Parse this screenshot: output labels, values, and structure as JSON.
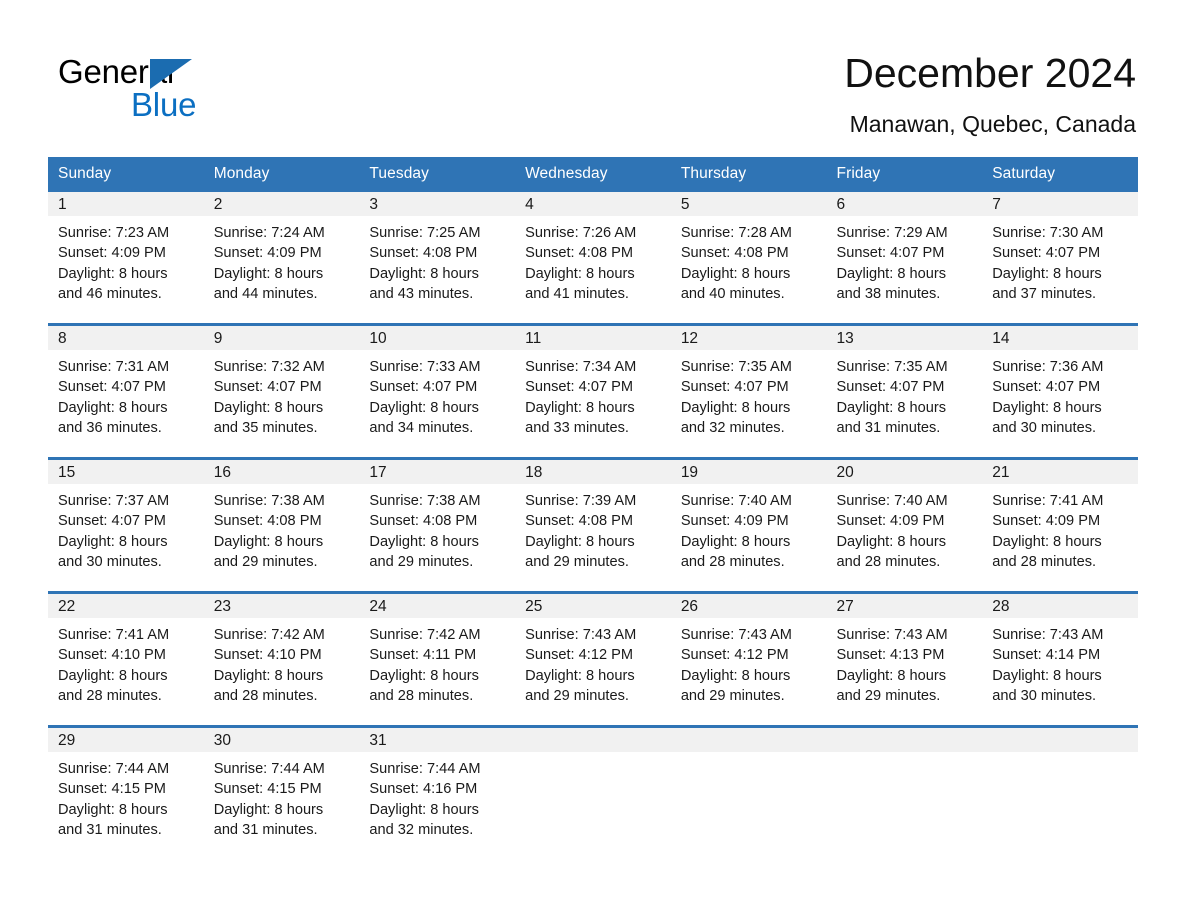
{
  "brand": {
    "name_part1": "General",
    "name_part2": "Blue",
    "accent_color": "#0b6fc2",
    "triangle_color": "#1b6cb0",
    "logo_icon": "blue-triangle-icon"
  },
  "header": {
    "title": "December 2024",
    "subtitle": "Manawan, Quebec, Canada"
  },
  "theme": {
    "header_bg": "#2f74b5",
    "header_text": "#ffffff",
    "daynum_band_bg": "#f1f1f1",
    "cell_bg": "#ffffff",
    "row_divider": "#2f74b5",
    "body_text": "#1a1a1a"
  },
  "weekday_headers": [
    "Sunday",
    "Monday",
    "Tuesday",
    "Wednesday",
    "Thursday",
    "Friday",
    "Saturday"
  ],
  "labels": {
    "sunrise_prefix": "Sunrise:",
    "sunset_prefix": "Sunset:",
    "daylight_prefix": "Daylight:"
  },
  "weeks": [
    [
      {
        "day": "1",
        "sunrise": "Sunrise: 7:23 AM",
        "sunset": "Sunset: 4:09 PM",
        "daylight_line1": "Daylight: 8 hours",
        "daylight_line2": "and 46 minutes."
      },
      {
        "day": "2",
        "sunrise": "Sunrise: 7:24 AM",
        "sunset": "Sunset: 4:09 PM",
        "daylight_line1": "Daylight: 8 hours",
        "daylight_line2": "and 44 minutes."
      },
      {
        "day": "3",
        "sunrise": "Sunrise: 7:25 AM",
        "sunset": "Sunset: 4:08 PM",
        "daylight_line1": "Daylight: 8 hours",
        "daylight_line2": "and 43 minutes."
      },
      {
        "day": "4",
        "sunrise": "Sunrise: 7:26 AM",
        "sunset": "Sunset: 4:08 PM",
        "daylight_line1": "Daylight: 8 hours",
        "daylight_line2": "and 41 minutes."
      },
      {
        "day": "5",
        "sunrise": "Sunrise: 7:28 AM",
        "sunset": "Sunset: 4:08 PM",
        "daylight_line1": "Daylight: 8 hours",
        "daylight_line2": "and 40 minutes."
      },
      {
        "day": "6",
        "sunrise": "Sunrise: 7:29 AM",
        "sunset": "Sunset: 4:07 PM",
        "daylight_line1": "Daylight: 8 hours",
        "daylight_line2": "and 38 minutes."
      },
      {
        "day": "7",
        "sunrise": "Sunrise: 7:30 AM",
        "sunset": "Sunset: 4:07 PM",
        "daylight_line1": "Daylight: 8 hours",
        "daylight_line2": "and 37 minutes."
      }
    ],
    [
      {
        "day": "8",
        "sunrise": "Sunrise: 7:31 AM",
        "sunset": "Sunset: 4:07 PM",
        "daylight_line1": "Daylight: 8 hours",
        "daylight_line2": "and 36 minutes."
      },
      {
        "day": "9",
        "sunrise": "Sunrise: 7:32 AM",
        "sunset": "Sunset: 4:07 PM",
        "daylight_line1": "Daylight: 8 hours",
        "daylight_line2": "and 35 minutes."
      },
      {
        "day": "10",
        "sunrise": "Sunrise: 7:33 AM",
        "sunset": "Sunset: 4:07 PM",
        "daylight_line1": "Daylight: 8 hours",
        "daylight_line2": "and 34 minutes."
      },
      {
        "day": "11",
        "sunrise": "Sunrise: 7:34 AM",
        "sunset": "Sunset: 4:07 PM",
        "daylight_line1": "Daylight: 8 hours",
        "daylight_line2": "and 33 minutes."
      },
      {
        "day": "12",
        "sunrise": "Sunrise: 7:35 AM",
        "sunset": "Sunset: 4:07 PM",
        "daylight_line1": "Daylight: 8 hours",
        "daylight_line2": "and 32 minutes."
      },
      {
        "day": "13",
        "sunrise": "Sunrise: 7:35 AM",
        "sunset": "Sunset: 4:07 PM",
        "daylight_line1": "Daylight: 8 hours",
        "daylight_line2": "and 31 minutes."
      },
      {
        "day": "14",
        "sunrise": "Sunrise: 7:36 AM",
        "sunset": "Sunset: 4:07 PM",
        "daylight_line1": "Daylight: 8 hours",
        "daylight_line2": "and 30 minutes."
      }
    ],
    [
      {
        "day": "15",
        "sunrise": "Sunrise: 7:37 AM",
        "sunset": "Sunset: 4:07 PM",
        "daylight_line1": "Daylight: 8 hours",
        "daylight_line2": "and 30 minutes."
      },
      {
        "day": "16",
        "sunrise": "Sunrise: 7:38 AM",
        "sunset": "Sunset: 4:08 PM",
        "daylight_line1": "Daylight: 8 hours",
        "daylight_line2": "and 29 minutes."
      },
      {
        "day": "17",
        "sunrise": "Sunrise: 7:38 AM",
        "sunset": "Sunset: 4:08 PM",
        "daylight_line1": "Daylight: 8 hours",
        "daylight_line2": "and 29 minutes."
      },
      {
        "day": "18",
        "sunrise": "Sunrise: 7:39 AM",
        "sunset": "Sunset: 4:08 PM",
        "daylight_line1": "Daylight: 8 hours",
        "daylight_line2": "and 29 minutes."
      },
      {
        "day": "19",
        "sunrise": "Sunrise: 7:40 AM",
        "sunset": "Sunset: 4:09 PM",
        "daylight_line1": "Daylight: 8 hours",
        "daylight_line2": "and 28 minutes."
      },
      {
        "day": "20",
        "sunrise": "Sunrise: 7:40 AM",
        "sunset": "Sunset: 4:09 PM",
        "daylight_line1": "Daylight: 8 hours",
        "daylight_line2": "and 28 minutes."
      },
      {
        "day": "21",
        "sunrise": "Sunrise: 7:41 AM",
        "sunset": "Sunset: 4:09 PM",
        "daylight_line1": "Daylight: 8 hours",
        "daylight_line2": "and 28 minutes."
      }
    ],
    [
      {
        "day": "22",
        "sunrise": "Sunrise: 7:41 AM",
        "sunset": "Sunset: 4:10 PM",
        "daylight_line1": "Daylight: 8 hours",
        "daylight_line2": "and 28 minutes."
      },
      {
        "day": "23",
        "sunrise": "Sunrise: 7:42 AM",
        "sunset": "Sunset: 4:10 PM",
        "daylight_line1": "Daylight: 8 hours",
        "daylight_line2": "and 28 minutes."
      },
      {
        "day": "24",
        "sunrise": "Sunrise: 7:42 AM",
        "sunset": "Sunset: 4:11 PM",
        "daylight_line1": "Daylight: 8 hours",
        "daylight_line2": "and 28 minutes."
      },
      {
        "day": "25",
        "sunrise": "Sunrise: 7:43 AM",
        "sunset": "Sunset: 4:12 PM",
        "daylight_line1": "Daylight: 8 hours",
        "daylight_line2": "and 29 minutes."
      },
      {
        "day": "26",
        "sunrise": "Sunrise: 7:43 AM",
        "sunset": "Sunset: 4:12 PM",
        "daylight_line1": "Daylight: 8 hours",
        "daylight_line2": "and 29 minutes."
      },
      {
        "day": "27",
        "sunrise": "Sunrise: 7:43 AM",
        "sunset": "Sunset: 4:13 PM",
        "daylight_line1": "Daylight: 8 hours",
        "daylight_line2": "and 29 minutes."
      },
      {
        "day": "28",
        "sunrise": "Sunrise: 7:43 AM",
        "sunset": "Sunset: 4:14 PM",
        "daylight_line1": "Daylight: 8 hours",
        "daylight_line2": "and 30 minutes."
      }
    ],
    [
      {
        "day": "29",
        "sunrise": "Sunrise: 7:44 AM",
        "sunset": "Sunset: 4:15 PM",
        "daylight_line1": "Daylight: 8 hours",
        "daylight_line2": "and 31 minutes."
      },
      {
        "day": "30",
        "sunrise": "Sunrise: 7:44 AM",
        "sunset": "Sunset: 4:15 PM",
        "daylight_line1": "Daylight: 8 hours",
        "daylight_line2": "and 31 minutes."
      },
      {
        "day": "31",
        "sunrise": "Sunrise: 7:44 AM",
        "sunset": "Sunset: 4:16 PM",
        "daylight_line1": "Daylight: 8 hours",
        "daylight_line2": "and 32 minutes."
      },
      {
        "day": "",
        "sunrise": "",
        "sunset": "",
        "daylight_line1": "",
        "daylight_line2": ""
      },
      {
        "day": "",
        "sunrise": "",
        "sunset": "",
        "daylight_line1": "",
        "daylight_line2": ""
      },
      {
        "day": "",
        "sunrise": "",
        "sunset": "",
        "daylight_line1": "",
        "daylight_line2": ""
      },
      {
        "day": "",
        "sunrise": "",
        "sunset": "",
        "daylight_line1": "",
        "daylight_line2": ""
      }
    ]
  ]
}
